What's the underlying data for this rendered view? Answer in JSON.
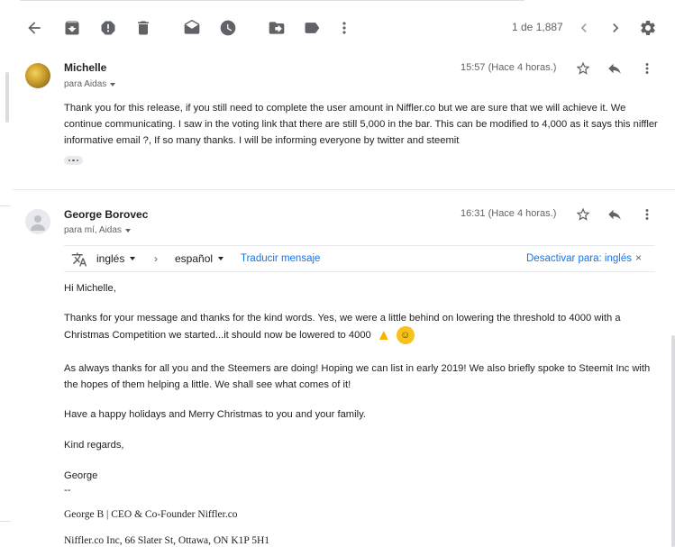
{
  "toolbar": {
    "icons": [
      "back-icon",
      "archive-icon",
      "report-spam-icon",
      "delete-icon",
      "mark-unread-icon",
      "snooze-icon",
      "move-to-icon",
      "label-icon",
      "more-vert-icon"
    ],
    "count": "1 de 1,887"
  },
  "messages": [
    {
      "sender": "Michelle",
      "recipients": "para Aidas",
      "time": "15:57 (Hace 4 horas.)",
      "body": "Thank you for this release, if you still need to complete the user amount in Niffler.co but we are sure that we will achieve it. We continue communicating. I saw in the voting link that there are still 5,000 in the bar. This can be modified to 4,000 as it says this niffler informative email ?, If so many thanks. I will be informing everyone by twitter and steemit"
    },
    {
      "sender": "George Borovec",
      "recipients": "para mí, Aidas",
      "time": "16:31 (Hace 4 horas.)",
      "translate": {
        "from": "inglés",
        "to": "español",
        "link": "Traducir mensaje",
        "disable": "Desactivar para: inglés",
        "close": "×"
      },
      "greeting": "Hi Michelle,",
      "para1": "Thanks for your message and thanks for the kind words. Yes, we were a little behind on lowering the threshold to 4000 with a Christmas Competition we started...it should now be lowered to 4000",
      "para2": "As always thanks for all you and the Steemers are doing!  Hoping we can list in early 2019!  We also briefly spoke to Steemit Inc with the hopes of them helping a little. We shall see what comes of it!",
      "para3": "Have a happy holidays and Merry Christmas to you and your family.",
      "closing": "Kind regards,",
      "name": "George",
      "dashes": "--",
      "sig1": "George B | CEO & Co-Founder Niffler.co",
      "sig2": "Niffler.co Inc, 66 Slater St, Ottawa, ON K1P 5H1"
    }
  ]
}
